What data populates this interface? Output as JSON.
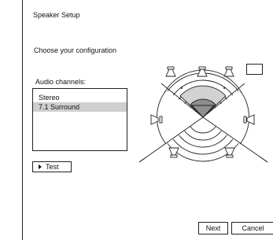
{
  "dialog": {
    "title": "Speaker Setup",
    "prompt": "Choose your configuration",
    "channels_label": "Audio channels:",
    "channels": [
      {
        "label": "Stereo",
        "selected": false
      },
      {
        "label": "7.1 Surround",
        "selected": true
      }
    ],
    "test_label": "Test",
    "next_label": "Next",
    "cancel_label": "Cancel"
  },
  "icons": {
    "test": "play-triangle-icon",
    "speaker": "speaker-icon"
  },
  "colors": {
    "selection": "#cfcfcf",
    "listener_inner": "#8e8e8e",
    "listener_outer": "#d2d2d2"
  }
}
